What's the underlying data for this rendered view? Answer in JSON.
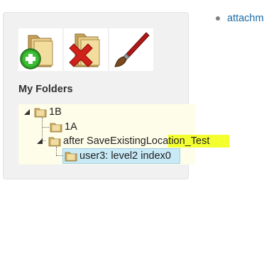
{
  "panel": {
    "toolbar": {
      "add_folder": {
        "icon": "folder-add-icon"
      },
      "delete_folder": {
        "icon": "folder-delete-icon"
      },
      "edit": {
        "icon": "paintbrush-icon"
      }
    },
    "heading": "My Folders",
    "tree": [
      {
        "label": "1B",
        "expanded": true,
        "children": [
          {
            "label": "1A"
          },
          {
            "label_before_highlight": "after SaveExistingLocation",
            "label_highlighted": "_Test",
            "expanded": true,
            "children": [
              {
                "label": "user3: level2 index0",
                "selected": true
              }
            ]
          }
        ]
      }
    ]
  },
  "side_links": [
    {
      "label": "attachm"
    }
  ],
  "colors": {
    "panel_bg": "#f1f1f1",
    "tree_bg": "#fdfde9",
    "highlight": "#f4ff2f",
    "selected_bg": "#c8e9f6",
    "link": "#1a6aa6"
  }
}
